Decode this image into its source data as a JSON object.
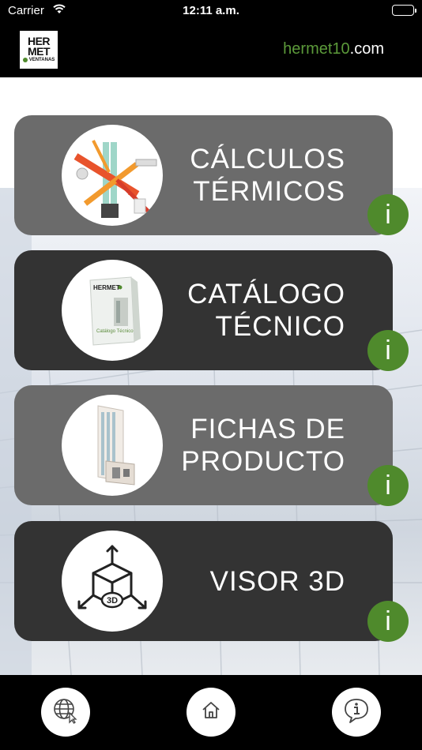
{
  "status_bar": {
    "carrier": "Carrier",
    "time": "12:11 a.m."
  },
  "header": {
    "logo": {
      "line1": "HER",
      "line2": "MET",
      "line3": "VENTANAS"
    },
    "site_prefix": "hermet10",
    "site_suffix": ".com"
  },
  "menu": [
    {
      "line1": "CÁLCULOS",
      "line2": "TÉRMICOS",
      "info": "i",
      "style": "light",
      "icon": "thermal-window-icon"
    },
    {
      "line1": "CATÁLOGO",
      "line2": "TÉCNICO",
      "info": "i",
      "style": "dark",
      "icon": "catalog-book-icon"
    },
    {
      "line1": "FICHAS DE",
      "line2": "PRODUCTO",
      "info": "i",
      "style": "light",
      "icon": "window-profile-icon"
    },
    {
      "line1": "VISOR 3D",
      "line2": "",
      "info": "i",
      "style": "dark",
      "icon": "cube-3d-icon"
    }
  ],
  "catalog_cover": {
    "brand": "HERMET",
    "title": "Catálogo Técnico"
  },
  "cube_label": "3D",
  "tab_bar": {
    "items": [
      "globe-icon",
      "home-icon",
      "info-icon"
    ]
  },
  "colors": {
    "accent_green": "#4f8a2c",
    "link_green": "#5c9a3a",
    "card_light": "#6b6b6b",
    "card_dark": "#333333"
  }
}
